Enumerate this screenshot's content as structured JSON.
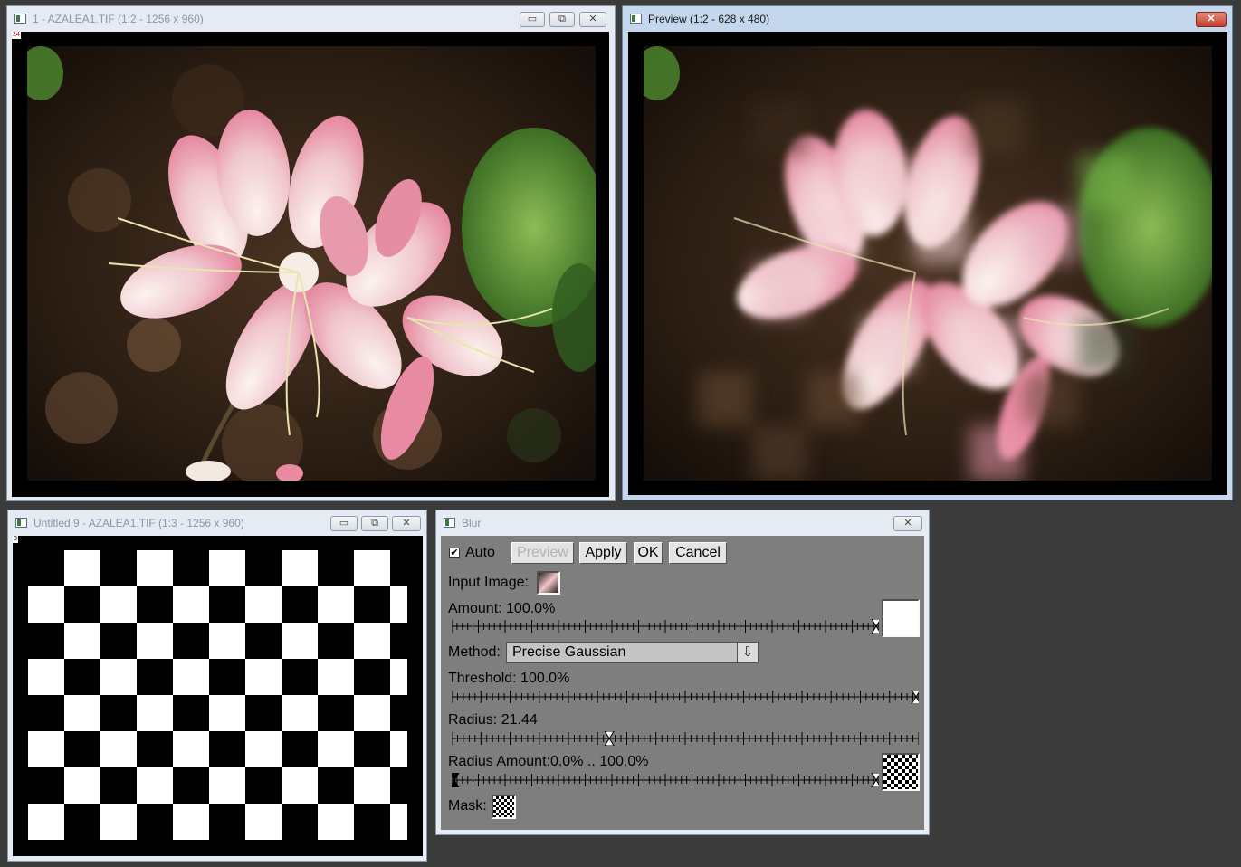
{
  "windows": {
    "original": {
      "title": "1 - AZALEA1.TIF (1:2 - 1256 x 960)",
      "badge": "24"
    },
    "preview": {
      "title": "Preview (1:2 - 628 x 480)"
    },
    "checker": {
      "title": "Untitled 9 - AZALEA1.TIF (1:3 - 1256 x 960)",
      "badge": "8"
    },
    "blur": {
      "title": "Blur"
    }
  },
  "title_buttons": {
    "minimize": "▭",
    "maximize": "⧉",
    "close": "✕"
  },
  "blur_dialog": {
    "auto_label": "Auto",
    "auto_checked": true,
    "check_mark": "✔",
    "preview_label": "Preview",
    "apply_label": "Apply",
    "ok_label": "OK",
    "cancel_label": "Cancel",
    "input_image_label": "Input Image:",
    "amount_label": "Amount: 100.0%",
    "amount_value": 1.0,
    "method_label": "Method:",
    "method_value": "Precise Gaussian",
    "method_arrow": "⇩",
    "threshold_label": "Threshold: 100.0%",
    "threshold_value": 1.0,
    "radius_label": "Radius: 21.44",
    "radius_value": 0.3375,
    "radius_amount_label": "Radius Amount:0.0% .. 100.0%",
    "radius_amount_min": 0.0,
    "radius_amount_max": 1.0,
    "mask_label": "Mask:"
  },
  "colors": {
    "dialog_bg": "#7e7e7e",
    "desktop": "#3b3b3b",
    "flower_pink": "#f3a9bd",
    "flower_white": "#f4e6e4"
  }
}
